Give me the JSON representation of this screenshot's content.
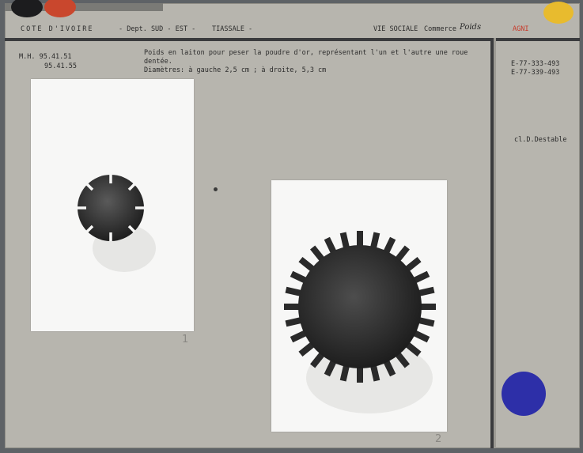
{
  "header": {
    "country": "COTE D'IVOIRE",
    "dept": "- Dept. SUD - EST -",
    "locality": "TIASSALE -",
    "theme": "VIE SOCIALE",
    "subtheme": "Commerce",
    "subtheme_handwritten": "Poids",
    "ethnic_group": "AGNI"
  },
  "inventory": {
    "line1": "M.H. 95.41.51",
    "line2": "95.41.55"
  },
  "description": {
    "line1": "Poids en laiton pour peser la poudre d'or, représentant l'un et l'autre une roue dentée.",
    "line2": "Diamètres: à gauche 2,5 cm ; à droite, 5,3 cm"
  },
  "side_refs": {
    "ref1": "E-77-333-493",
    "ref2": "E-77-339-493"
  },
  "credit": "cl.D.Destable",
  "photo_marks": {
    "mark1": "1",
    "mark2": "2"
  },
  "colors": {
    "card": "#b7b5ae",
    "dot_black": "#1c1c1e",
    "dot_red": "#c9472d",
    "dot_yellow": "#e8bb2e",
    "dot_blue": "#2d2fa8",
    "subtheme_highlight": "#c83a2a"
  }
}
